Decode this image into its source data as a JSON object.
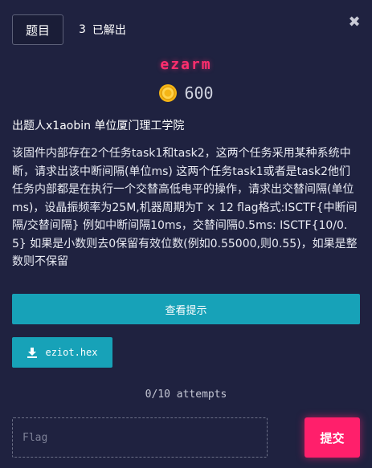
{
  "header": {
    "tab_label": "题目",
    "solved_count": "3",
    "solved_label": "已解出",
    "close_icon": "close-icon"
  },
  "challenge": {
    "title": "ezarm",
    "points": "600",
    "coin_icon": "coin-icon",
    "author_line": "出题人x1aobin 单位厦门理工学院",
    "description": "该固件内部存在2个任务task1和task2，这两个任务采用某种系统中断，请求出该中断间隔(单位ms) 这两个任务task1或者是task2他们任务内部都是在执行一个交替高低电平的操作，请求出交替间隔(单位ms)，设晶振频率为25M,机器周期为T × 12 flag格式:ISCTF{中断间隔/交替间隔} 例如中断间隔10ms，交替间隔0.5ms: ISCTF{10/0.5} 如果是小数则去0保留有效位数(例如0.55000,则0.55)，如果是整数则不保留"
  },
  "buttons": {
    "hint_label": "查看提示",
    "file_label": "eziot.hex",
    "download_icon": "download-icon",
    "submit_label": "提交"
  },
  "attempts_text": "0/10 attempts",
  "flag_input": {
    "placeholder": "Flag",
    "value": ""
  },
  "colors": {
    "background": "#1f2240",
    "accent": "#17a2b8",
    "title": "#ff2e6e",
    "submit": "#ff1f6b"
  }
}
